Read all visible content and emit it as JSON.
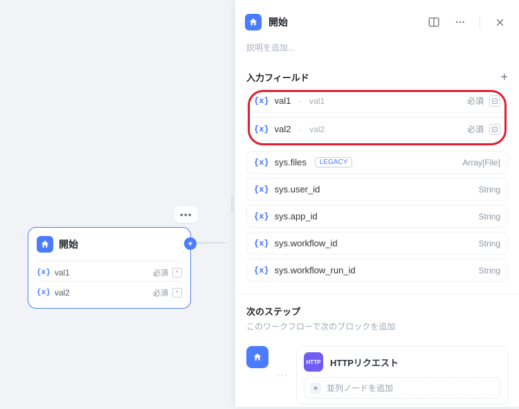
{
  "colors": {
    "accent": "#4c7cfe",
    "danger": "#e11d2e",
    "http": "#6f5cf3"
  },
  "canvas": {
    "node": {
      "title": "開始",
      "vars": [
        {
          "name": "val1",
          "required_label": "必須"
        },
        {
          "name": "val2",
          "required_label": "必須"
        }
      ]
    }
  },
  "panel": {
    "title": "開始",
    "description_placeholder": "説明を追加...",
    "input_fields": {
      "title": "入力フィールド",
      "items": [
        {
          "name": "val1",
          "sub": "val1",
          "type": "",
          "required_label": "必須",
          "editable": true
        },
        {
          "name": "val2",
          "sub": "val2",
          "type": "",
          "required_label": "必須",
          "editable": true
        },
        {
          "name": "sys.files",
          "sub": "",
          "type": "Array[File]",
          "badge": "LEGACY",
          "editable": false
        },
        {
          "name": "sys.user_id",
          "sub": "",
          "type": "String",
          "editable": false
        },
        {
          "name": "sys.app_id",
          "sub": "",
          "type": "String",
          "editable": false
        },
        {
          "name": "sys.workflow_id",
          "sub": "",
          "type": "String",
          "editable": false
        },
        {
          "name": "sys.workflow_run_id",
          "sub": "",
          "type": "String",
          "editable": false
        }
      ]
    },
    "next": {
      "title": "次のステップ",
      "subtitle": "このワークフローで次のブロックを追加",
      "http_label": "HTTPリクエスト",
      "http_badge": "HTTP",
      "add_parallel": "並列ノードを追加"
    }
  },
  "icons": {
    "variable": "{x}",
    "star": "*"
  }
}
